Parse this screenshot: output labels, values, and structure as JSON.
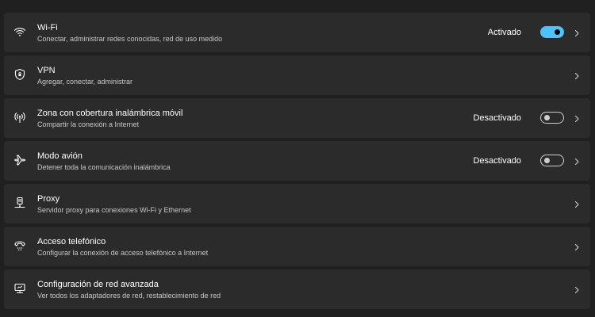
{
  "accent_color": "#4cc2ff",
  "items": [
    {
      "icon": "wifi-icon",
      "title": "Wi-Fi",
      "subtitle": "Conectar, administrar redes conocidas, red de uso medido",
      "state": "Activado",
      "toggle_on": true
    },
    {
      "icon": "vpn-shield-icon",
      "title": "VPN",
      "subtitle": "Agregar, conectar, administrar"
    },
    {
      "icon": "hotspot-icon",
      "title": "Zona con cobertura inalámbrica móvil",
      "subtitle": "Compartir la conexión a Internet",
      "state": "Desactivado",
      "toggle_on": false
    },
    {
      "icon": "airplane-icon",
      "title": "Modo avión",
      "subtitle": "Detener toda la comunicación inalámbrica",
      "state": "Desactivado",
      "toggle_on": false
    },
    {
      "icon": "proxy-icon",
      "title": "Proxy",
      "subtitle": "Servidor proxy para conexiones Wi-Fi y Ethernet"
    },
    {
      "icon": "dial-up-icon",
      "title": "Acceso telefónico",
      "subtitle": "Configurar la conexión de acceso telefónico a Internet"
    },
    {
      "icon": "advanced-network-icon",
      "title": "Configuración de red avanzada",
      "subtitle": "Ver todos los adaptadores de red, restablecimiento de red"
    }
  ]
}
